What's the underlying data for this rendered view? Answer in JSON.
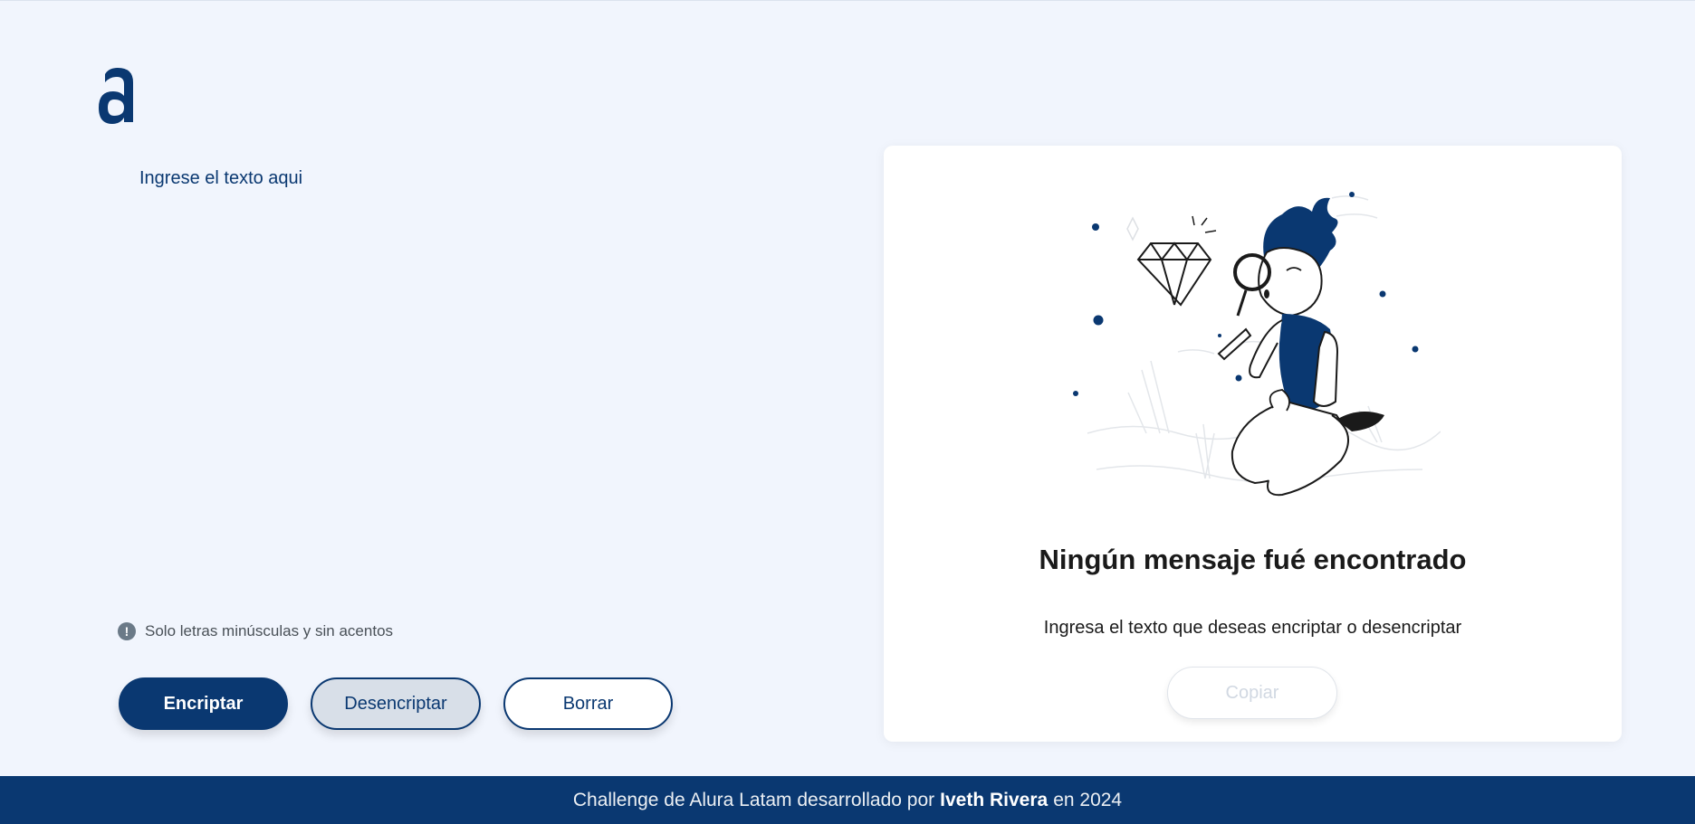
{
  "app": {
    "logo_icon": "alura-a-logo-icon"
  },
  "colors": {
    "primary": "#0a3871",
    "background": "#f1f5fd",
    "card": "#ffffff",
    "secondary_button": "#d8dfe8"
  },
  "editor": {
    "placeholder": "Ingrese el texto aqui",
    "value": ""
  },
  "hint": {
    "icon": "exclamation-circle-icon",
    "text": "Solo letras minúsculas y sin acentos"
  },
  "actions": {
    "encrypt_label": "Encriptar",
    "decrypt_label": "Desencriptar",
    "clear_label": "Borrar"
  },
  "output": {
    "illustration": "person-with-magnifying-glass-icon",
    "title": "Ningún mensaje fué encontrado",
    "subtitle": "Ingresa el texto que deseas encriptar o desencriptar",
    "copy_label": "Copiar"
  },
  "footer": {
    "prefix": "Challenge de Alura Latam desarrollado por",
    "author": "Iveth Rivera",
    "suffix": "en 2024"
  }
}
